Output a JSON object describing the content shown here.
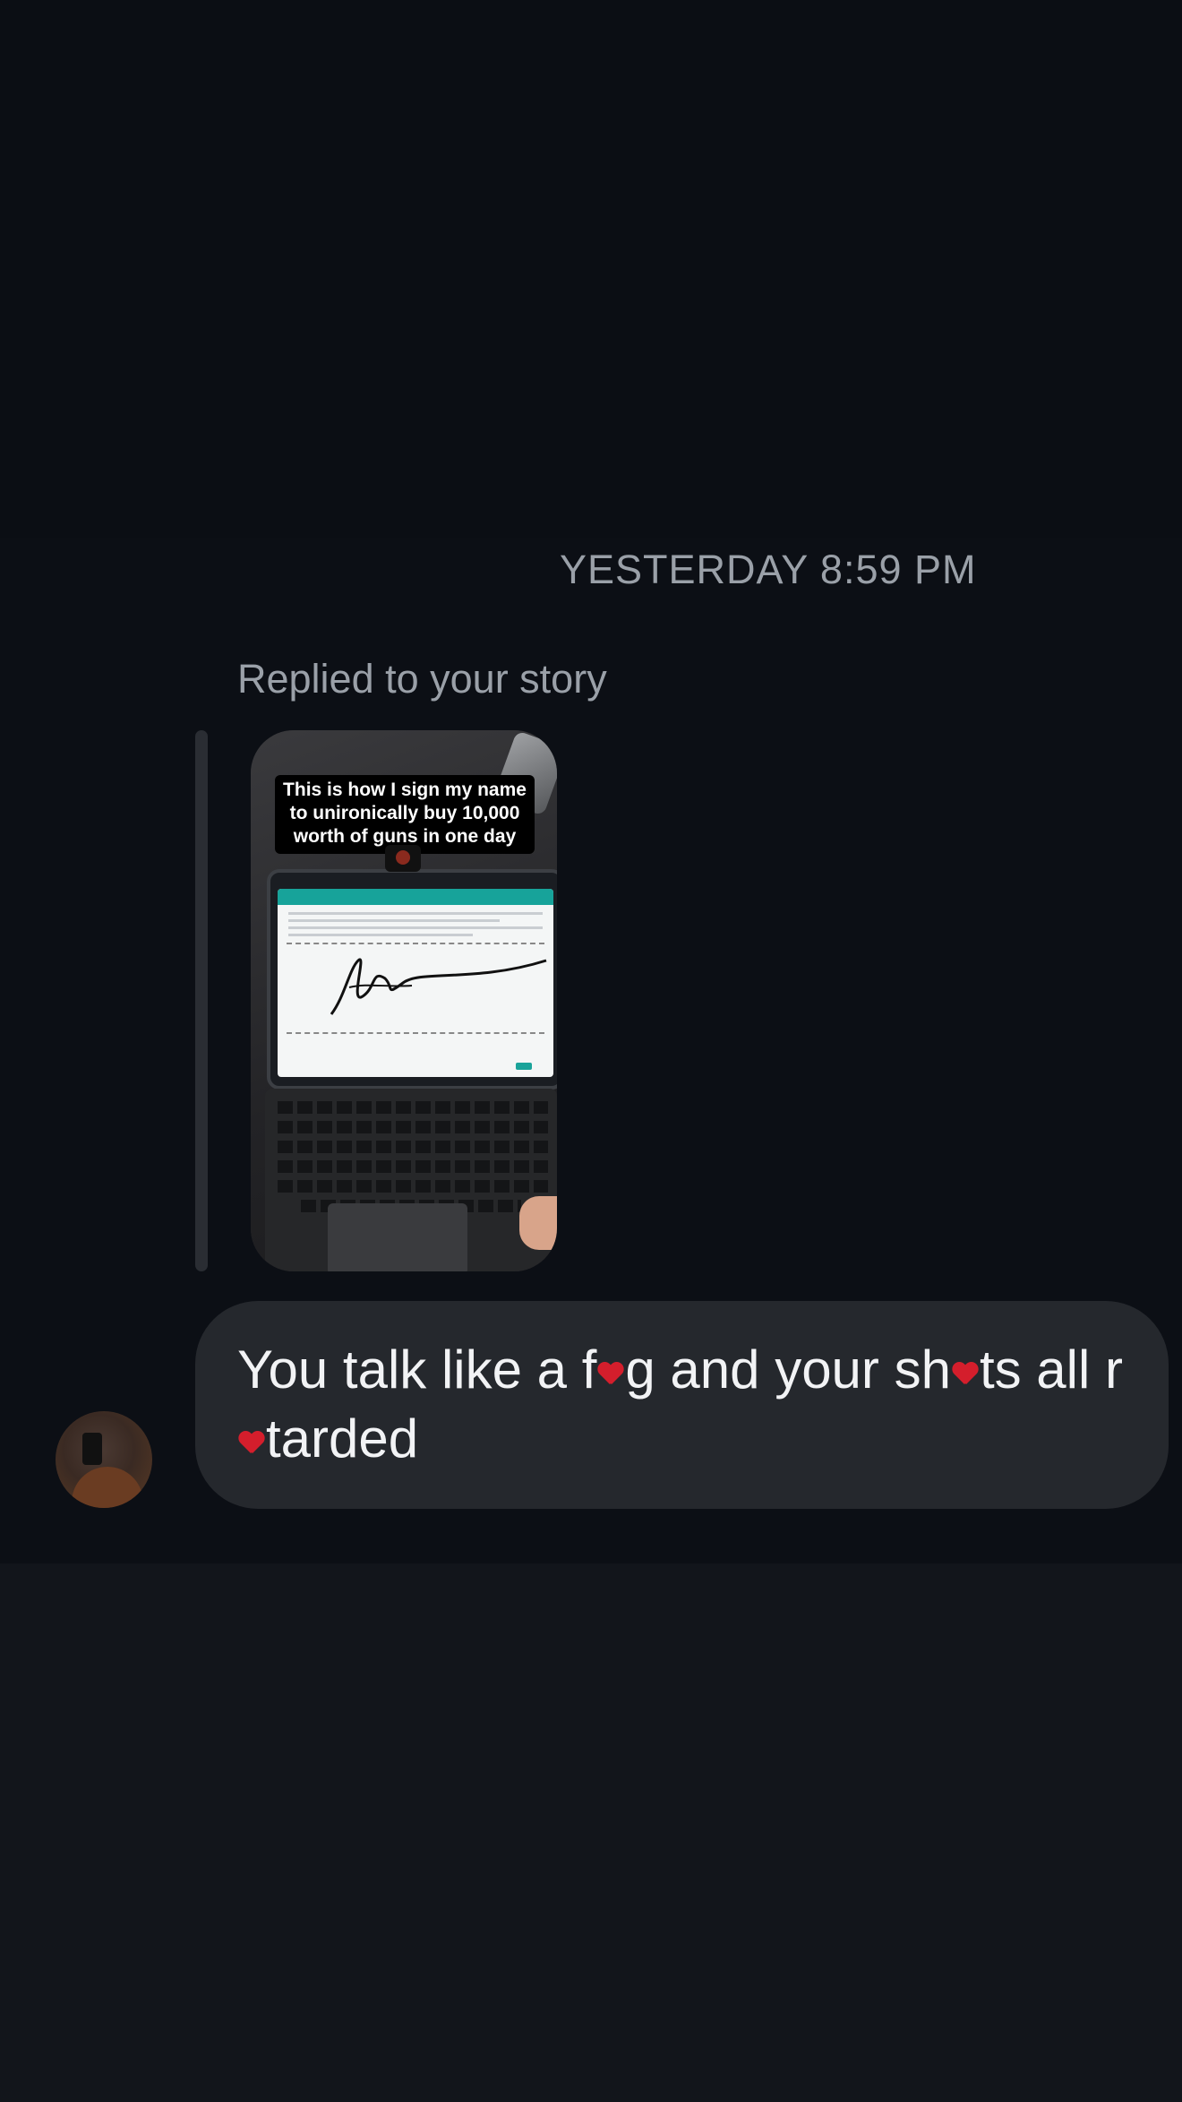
{
  "thread": {
    "timestamp": "YESTERDAY 8:59 PM",
    "reply_context": "Replied to your story"
  },
  "story": {
    "caption_line1": "This is how I sign my name",
    "caption_line2": "to unironically buy 10,000",
    "caption_line3": "worth of guns in one day"
  },
  "message": {
    "part1": "You talk like a f",
    "part2": "g and your sh",
    "part3": "ts all r",
    "part4": "tarded",
    "censor_emoji": "red-heart-icon",
    "censor_color": "#d41e2c"
  },
  "colors": {
    "background": "#0c0f15",
    "bubble": "#25282d",
    "secondary_text": "#9aa0a8"
  }
}
